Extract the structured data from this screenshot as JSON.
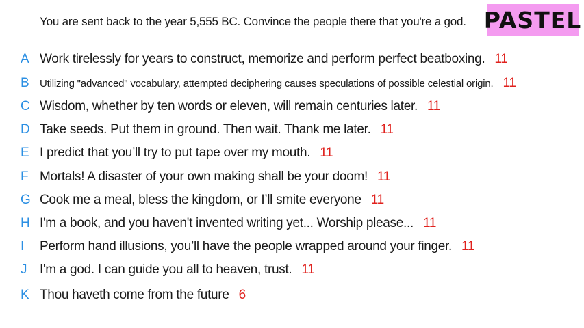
{
  "prompt": "You are sent back to the year 5,555 BC. Convince the people there that you're a god.",
  "badge": "PASTEL",
  "colors": {
    "letter": "#2b8fe3",
    "score": "#e0211d",
    "badge_bg": "#f49bf0"
  },
  "entries": [
    {
      "letter": "A",
      "text": "Work tirelessly for years to construct, memorize and perform perfect beatboxing.",
      "score": "11"
    },
    {
      "letter": "B",
      "text": "Utilizing \"advanced\" vocabulary, attempted deciphering causes speculations of possible celestial origin.",
      "score": "11"
    },
    {
      "letter": "C",
      "text": "Wisdom, whether by ten words or eleven, will remain centuries later.",
      "score": "11"
    },
    {
      "letter": "D",
      "text": "Take seeds. Put them in ground. Then wait. Thank me later.",
      "score": "11"
    },
    {
      "letter": "E",
      "text": "I predict that you’ll try to put tape over my mouth.",
      "score": "11"
    },
    {
      "letter": "F",
      "text": "Mortals! A disaster of your own making shall be your doom!",
      "score": "11"
    },
    {
      "letter": "G",
      "text": "Cook me a meal, bless the kingdom, or I’ll smite everyone",
      "score": "11"
    },
    {
      "letter": "H",
      "text": "I'm a book, and you haven't invented writing yet... Worship please...",
      "score": "11"
    },
    {
      "letter": "I",
      "text": "Perform hand illusions, you’ll have the people wrapped around your finger.",
      "score": "11"
    },
    {
      "letter": "J",
      "text": "I'm a god. I can guide you all to heaven, trust.",
      "score": "11"
    },
    {
      "letter": "K",
      "text": "Thou haveth come from the future",
      "score": "6"
    }
  ]
}
